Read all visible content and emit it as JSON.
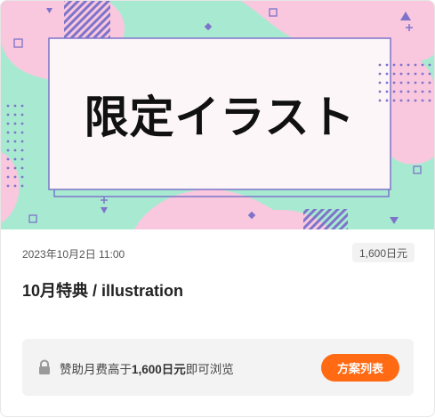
{
  "post": {
    "banner_text": "限定イラスト",
    "date": "2023年10月2日 11:00",
    "price": "1,600日元",
    "title": "10月特典 / illustration"
  },
  "lock": {
    "text_before": "赞助月费高于",
    "amount": "1,600日元",
    "text_after": "即可浏览",
    "button_label": "方案列表",
    "icon": "lock-icon"
  },
  "colors": {
    "banner_bg": "#a8ead1",
    "blob_pink": "#f9c7de",
    "accent_purple": "#7d74c9",
    "button_orange": "#ff6a13"
  }
}
